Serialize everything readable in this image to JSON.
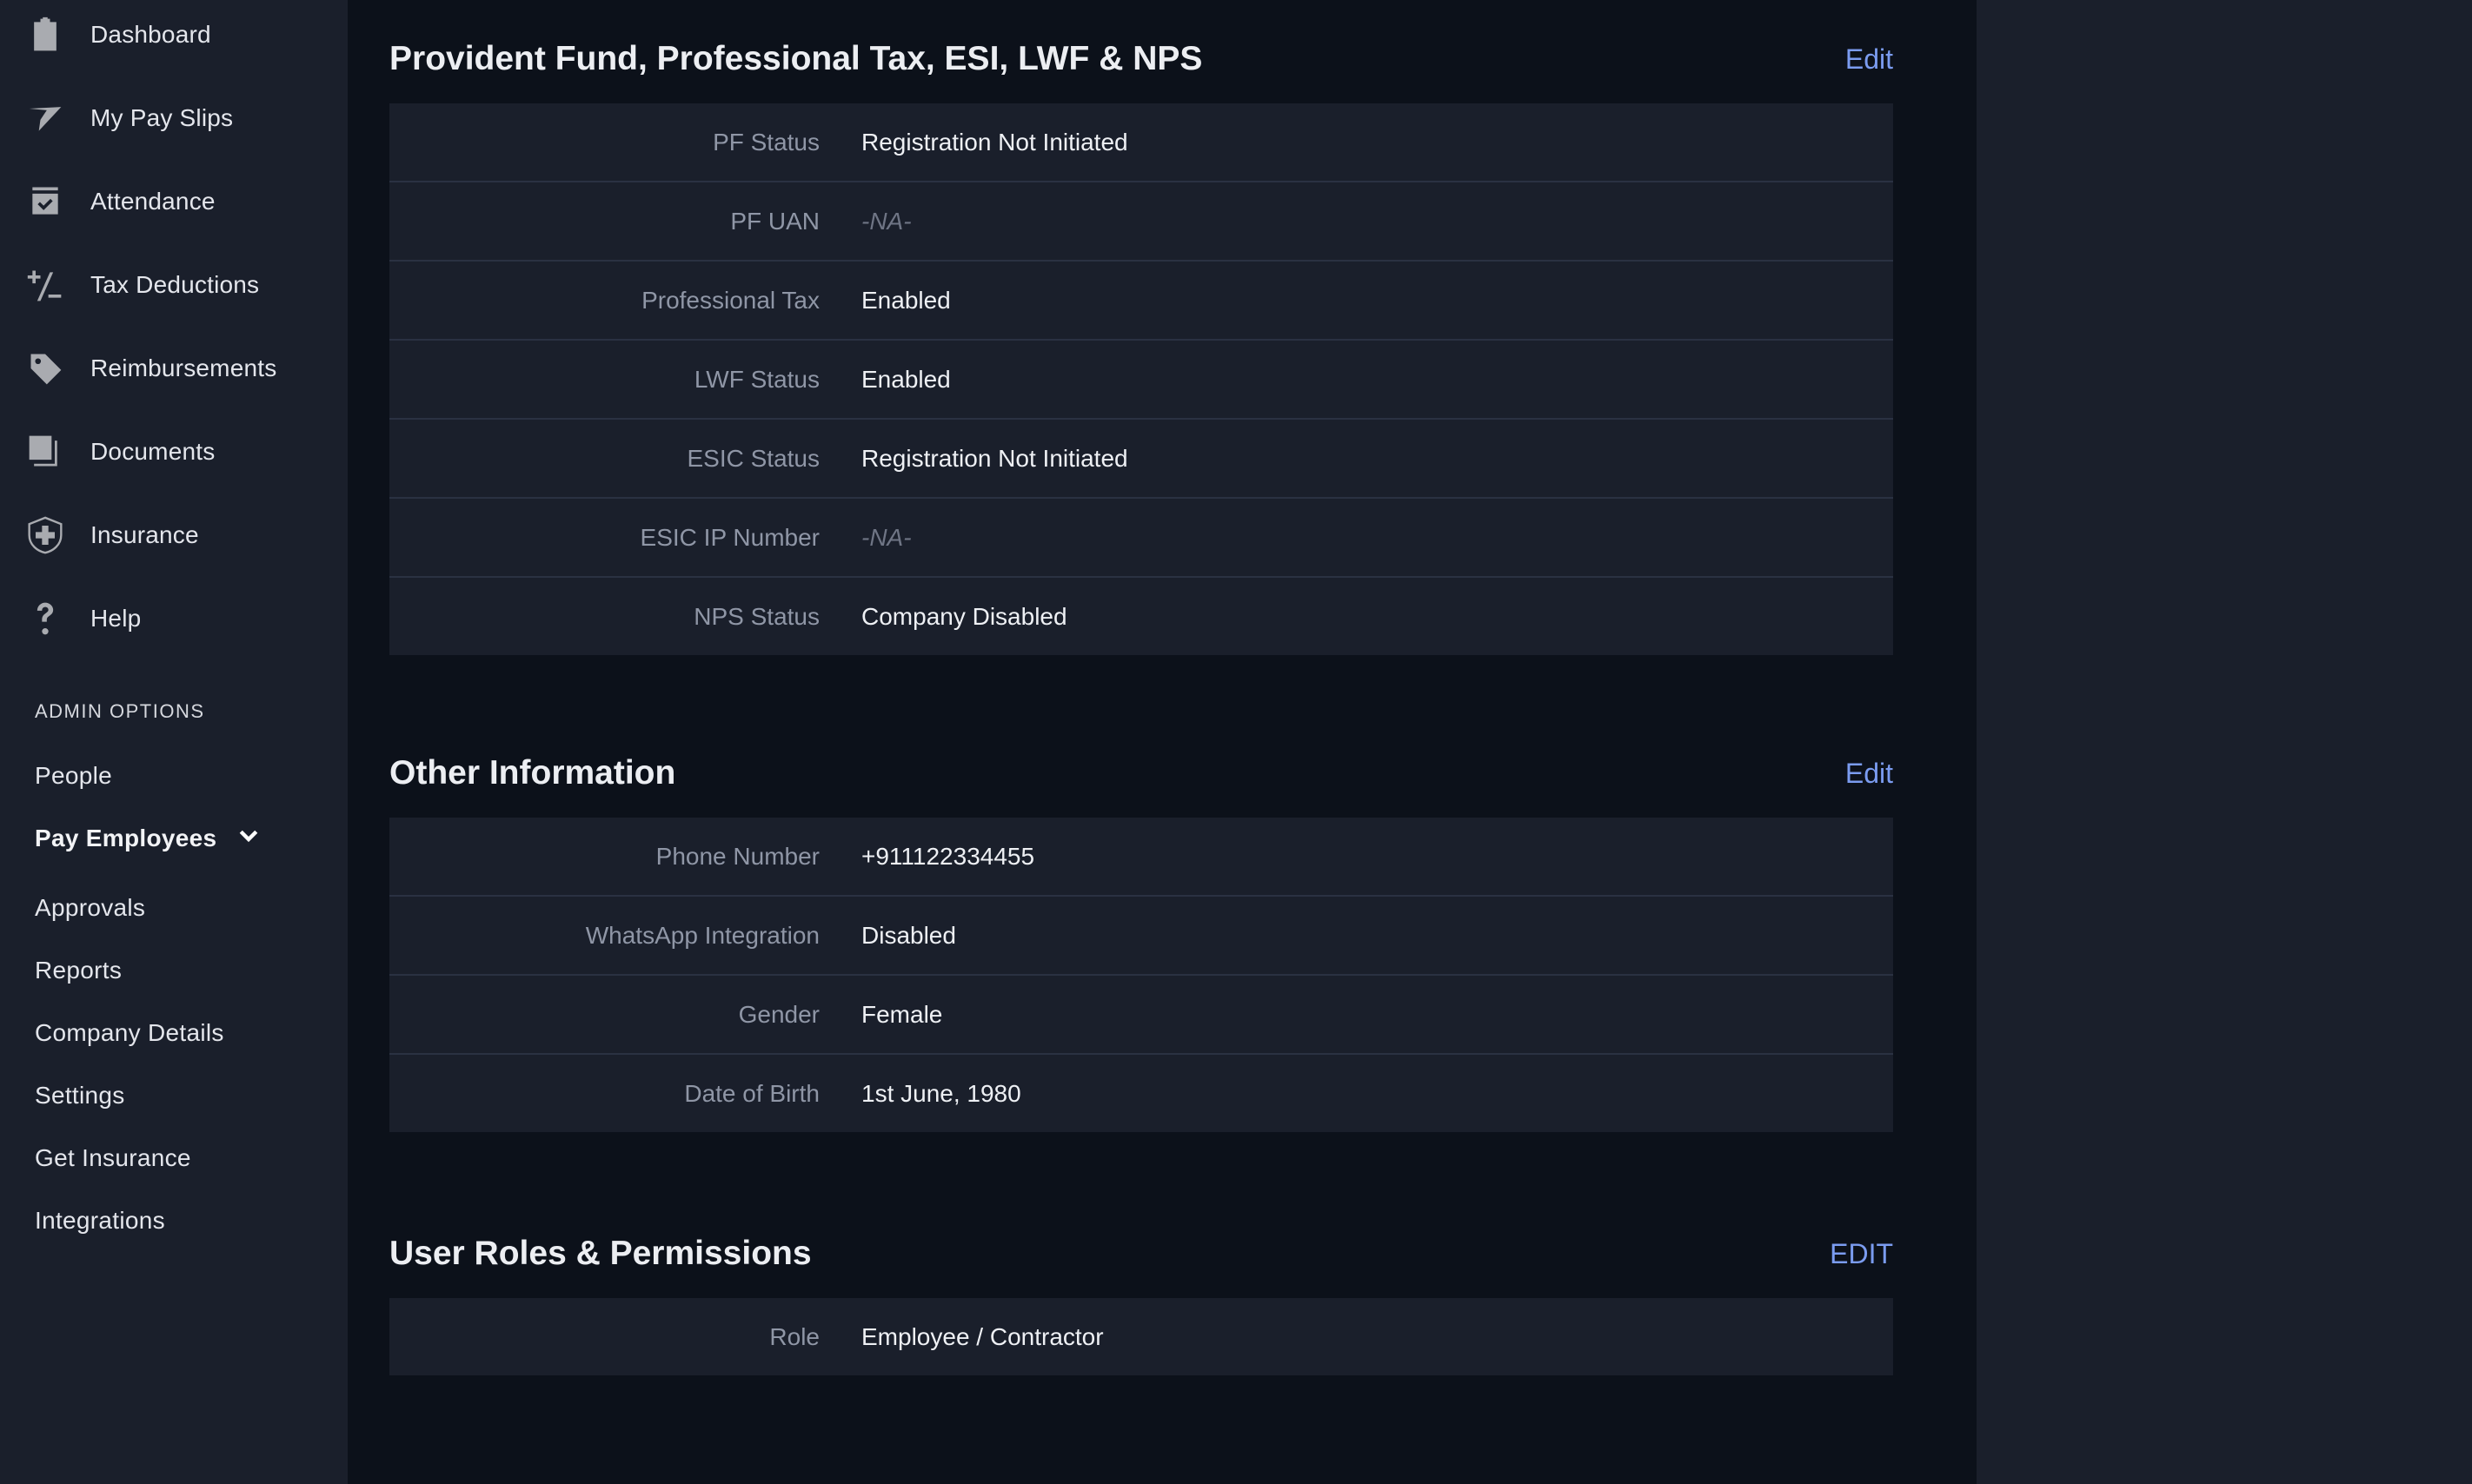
{
  "sidebar": {
    "nav_items": [
      {
        "label": "Dashboard",
        "icon": "clipboard-icon"
      },
      {
        "label": "My Pay Slips",
        "icon": "paper-plane-icon"
      },
      {
        "label": "Attendance",
        "icon": "calendar-check-icon"
      },
      {
        "label": "Tax Deductions",
        "icon": "plus-minus-icon"
      },
      {
        "label": "Reimbursements",
        "icon": "tag-icon"
      },
      {
        "label": "Documents",
        "icon": "documents-icon"
      },
      {
        "label": "Insurance",
        "icon": "shield-plus-icon"
      },
      {
        "label": "Help",
        "icon": "question-icon"
      }
    ],
    "admin_heading": "ADMIN OPTIONS",
    "admin_items": [
      {
        "label": "People"
      },
      {
        "label": "Pay Employees",
        "active": true,
        "expandable": true
      },
      {
        "label": "Approvals"
      },
      {
        "label": "Reports"
      },
      {
        "label": "Company Details"
      },
      {
        "label": "Settings"
      },
      {
        "label": "Get Insurance"
      },
      {
        "label": "Integrations"
      }
    ]
  },
  "sections": [
    {
      "title": "Provident Fund, Professional Tax, ESI, LWF & NPS",
      "edit_label": "Edit",
      "rows": [
        {
          "label": "PF Status",
          "value": "Registration Not Initiated",
          "na": false
        },
        {
          "label": "PF UAN",
          "value": "-NA-",
          "na": true
        },
        {
          "label": "Professional Tax",
          "value": "Enabled",
          "na": false
        },
        {
          "label": "LWF Status",
          "value": "Enabled",
          "na": false
        },
        {
          "label": "ESIC Status",
          "value": "Registration Not Initiated",
          "na": false
        },
        {
          "label": "ESIC IP Number",
          "value": "-NA-",
          "na": true
        },
        {
          "label": "NPS Status",
          "value": "Company Disabled",
          "na": false
        }
      ]
    },
    {
      "title": "Other Information",
      "edit_label": "Edit",
      "rows": [
        {
          "label": "Phone Number",
          "value": "+911122334455",
          "na": false
        },
        {
          "label": "WhatsApp Integration",
          "value": "Disabled",
          "na": false
        },
        {
          "label": "Gender",
          "value": "Female",
          "na": false
        },
        {
          "label": "Date of Birth",
          "value": "1st June, 1980",
          "na": false
        }
      ]
    },
    {
      "title": "User Roles & Permissions",
      "edit_label": "EDIT",
      "rows": [
        {
          "label": "Role",
          "value": "Employee / Contractor",
          "na": false
        }
      ]
    }
  ],
  "colors": {
    "accent": "#7b9cf0",
    "sidebar_bg": "#1a1f2b",
    "main_bg": "#0c111a",
    "card_bg": "#1a1f2b"
  }
}
